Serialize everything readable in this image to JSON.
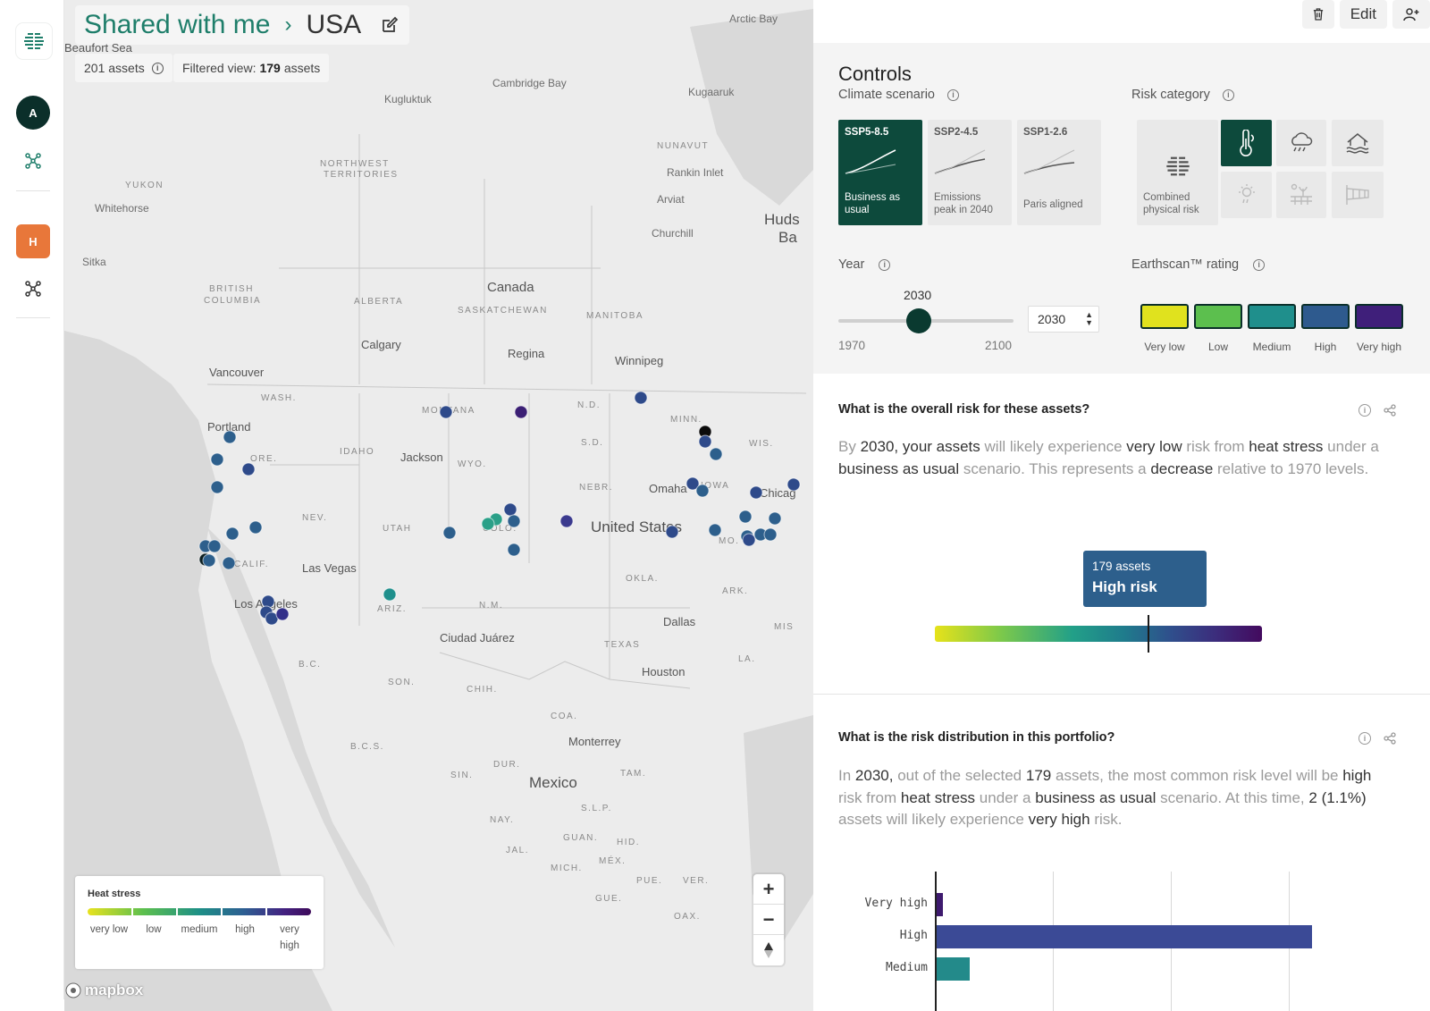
{
  "rail": {
    "avatar_a": "A",
    "avatar_h": "H"
  },
  "map": {
    "breadcrumb_root": "Shared with me",
    "breadcrumb_sep": "›",
    "breadcrumb_current": "USA",
    "assets_count": "201 assets",
    "filtered_prefix": "Filtered view:",
    "filtered_count": "179",
    "filtered_suffix": "assets",
    "legend": {
      "title": "Heat stress",
      "labels": [
        "very low",
        "low",
        "medium",
        "high",
        "very",
        "high"
      ]
    },
    "zoom_in": "+",
    "zoom_out": "−",
    "attribution": "mapbox",
    "places": {
      "arctic_bay": "Arctic Bay",
      "cambridge_bay": "Cambridge Bay",
      "kugluktuk": "Kugluktuk",
      "kugaaruk": "Kugaaruk",
      "nunavut": "NUNAVUT",
      "nwt1": "NORTHWEST",
      "nwt2": "TERRITORIES",
      "rankin": "Rankin Inlet",
      "yukon": "YUKON",
      "whitehorse": "Whitehorse",
      "arviat": "Arviat",
      "hudson1": "Huds",
      "hudson2": "Ba",
      "churchill": "Churchill",
      "sitka": "Sitka",
      "bc1": "BRITISH",
      "bc2": "COLUMBIA",
      "alberta": "ALBERTA",
      "canada": "Canada",
      "sask": "SASKATCHEWAN",
      "manitoba": "MANITOBA",
      "calgary": "Calgary",
      "regina": "Regina",
      "winnipeg": "Winnipeg",
      "vancouver": "Vancouver",
      "wash": "WASH.",
      "montana": "MONTANA",
      "nd": "N.D.",
      "minn": "MINN.",
      "portland": "Portland",
      "ore": "ORE.",
      "idaho": "IDAHO",
      "jackson": "Jackson",
      "wyo": "WYO.",
      "sd": "S.D.",
      "wis": "WIS.",
      "nebr": "NEBR.",
      "omaha": "Omaha",
      "iowa": "IOWA",
      "chicago": "Chicag",
      "nev": "NEV.",
      "utah": "UTAH",
      "colo": "COLO.",
      "us": "United States",
      "mo": "MO.",
      "calif": "CALIF.",
      "lasvegas": "Las Vegas",
      "okla": "OKLA.",
      "ark": "ARK.",
      "la_city": "Los Angeles",
      "ariz": "ARIZ.",
      "nm": "N.M.",
      "dallas": "Dallas",
      "mis": "MIS",
      "ciudad": "Ciudad Juárez",
      "texas": "TEXAS",
      "bc_mx": "B.C.",
      "la_state": "LA.",
      "houston": "Houston",
      "son": "SON.",
      "chih": "CHIH.",
      "coa": "COA.",
      "bcs": "B.C.S.",
      "monterrey": "Monterrey",
      "dur": "DUR.",
      "tam": "TAM.",
      "sin": "SIN.",
      "mexico": "Mexico",
      "slp": "S.L.P.",
      "nay": "NAY.",
      "guan": "GUAN.",
      "hid": "HID.",
      "jal": "JAL.",
      "mex": "MÉX.",
      "mich": "MICH.",
      "pue": "PUE.",
      "ver": "VER.",
      "gue": "GUE.",
      "oax": "OAX.",
      "beaufort": "Beaufort Sea"
    }
  },
  "panel": {
    "edit_label": "Edit",
    "controls_title": "Controls",
    "climate_label": "Climate scenario",
    "risk_label": "Risk category",
    "scenarios": [
      {
        "code": "SSP5-8.5",
        "desc1": "Business as",
        "desc2": "usual"
      },
      {
        "code": "SSP2-4.5",
        "desc1": "Emissions",
        "desc2": "peak in 2040"
      },
      {
        "code": "SSP1-2.6",
        "desc1": "Paris aligned",
        "desc2": ""
      }
    ],
    "combined_desc1": "Combined",
    "combined_desc2": "physical risk",
    "year_label": "Year",
    "year_value": "2030",
    "year_min": "1970",
    "year_max": "2100",
    "year_input": "2030",
    "rating_label": "Earthscan™ rating",
    "ratings": [
      "Very low",
      "Low",
      "Medium",
      "High",
      "Very high"
    ],
    "rating_colors": [
      "#e0e21e",
      "#5cbf4e",
      "#1f8f8c",
      "#2e5a8e",
      "#3f1f7a"
    ],
    "q1": "What is the overall risk for these assets?",
    "p1": {
      "a": "By",
      "b": "2030,",
      "c": "your assets",
      "d": "will likely experience",
      "e": "very low",
      "f": "risk from",
      "g": "heat stress",
      "h": "under a",
      "i": "business as usual",
      "j": "scenario. This represents a",
      "k": "decrease",
      "l": "relative to",
      "m": "1970 levels."
    },
    "tooltip_count": "179 assets",
    "tooltip_level": "High risk",
    "q2": "What is the risk distribution in this portfolio?",
    "p2": {
      "a": "In",
      "b": "2030,",
      "c": "out of the selected",
      "d": "179",
      "e": "assets, the most common risk level will be",
      "f": "high",
      "g": "risk from",
      "h": "heat stress",
      "i": "under a",
      "j": "business as usual",
      "k": "scenario. At this time,",
      "l": "2",
      "m": "(1.1%)",
      "n": "assets will likely experience",
      "o": "very high",
      "p": "risk."
    }
  },
  "chart_data": {
    "type": "bar",
    "orientation": "horizontal",
    "categories": [
      "Very high",
      "High",
      "Medium"
    ],
    "values": [
      2,
      125,
      11
    ],
    "colors": [
      "#3e1a6e",
      "#3b4a96",
      "#238a8a"
    ]
  }
}
